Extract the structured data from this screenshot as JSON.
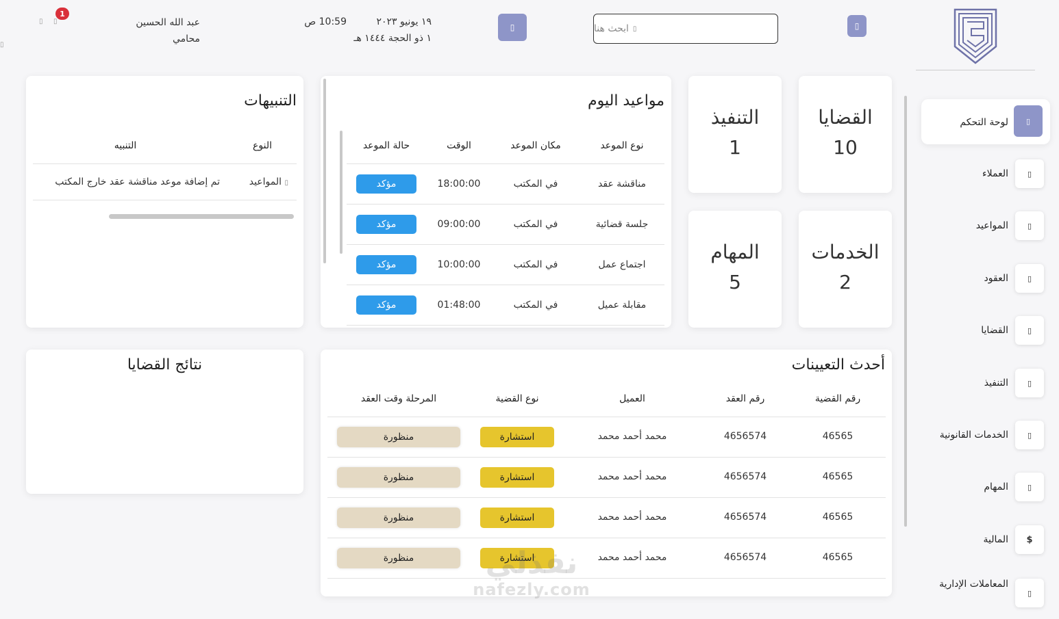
{
  "header": {
    "search_placeholder": "ابحث هنا",
    "date_gregorian": "١٩ يونيو ٢٠٢٣",
    "date_hijri": "١ ذو الحجة ١٤٤٤ هـ",
    "time": "10:59 ص",
    "user_name": "عبد الله الحسين",
    "user_role": "محامي",
    "notification_count": "1"
  },
  "sidebar": {
    "items": [
      {
        "label": "لوحة التحكم",
        "icon": "dashboard-icon"
      },
      {
        "label": "العملاء",
        "icon": "clients-icon"
      },
      {
        "label": "المواعيد",
        "icon": "calendar-icon"
      },
      {
        "label": "العقود",
        "icon": "contract-icon"
      },
      {
        "label": "القضايا",
        "icon": "case-icon"
      },
      {
        "label": "التنفيذ",
        "icon": "execution-icon"
      },
      {
        "label": "الخدمات القانونية",
        "icon": "services-icon"
      },
      {
        "label": "المهام",
        "icon": "tasks-icon"
      },
      {
        "label": "المالية",
        "icon": "dollar-icon",
        "glyph": "$"
      },
      {
        "label": "المعاملات الإدارية",
        "icon": "admin-icon"
      }
    ]
  },
  "stats": {
    "cases": {
      "label": "القضايا",
      "value": "10"
    },
    "execution": {
      "label": "التنفيذ",
      "value": "1"
    },
    "services": {
      "label": "الخدمات",
      "value": "2"
    },
    "tasks": {
      "label": "المهام",
      "value": "5"
    }
  },
  "appointments": {
    "title": "مواعيد اليوم",
    "columns": [
      "نوع الموعد",
      "مكان الموعد",
      "الوقت",
      "حالة الموعد"
    ],
    "rows": [
      {
        "type": "مناقشة عقد",
        "place": "في المكتب",
        "time": "18:00:00",
        "status": "مؤكد"
      },
      {
        "type": "جلسة قضائية",
        "place": "في المكتب",
        "time": "09:00:00",
        "status": "مؤكد"
      },
      {
        "type": "اجتماع عمل",
        "place": "في المكتب",
        "time": "10:00:00",
        "status": "مؤكد"
      },
      {
        "type": "مقابلة عميل",
        "place": "في المكتب",
        "time": "01:48:00",
        "status": "مؤكد"
      }
    ]
  },
  "alerts": {
    "title": "التنبيهات",
    "columns": [
      "النوع",
      "التنبيه"
    ],
    "rows": [
      {
        "type": "المواعيد",
        "message": "تم إضافة موعد مناقشة عقد خارج المكتب"
      }
    ]
  },
  "assignments": {
    "title": "أحدث التعيينات",
    "columns": [
      "رقم القضية",
      "رقم العقد",
      "العميل",
      "نوع القضية",
      "المرحلة وقت العقد"
    ],
    "rows": [
      {
        "case_no": "46565",
        "contract_no": "4656574",
        "client": "محمد أحمد محمد",
        "case_type": "استشارة",
        "stage": "منظورة"
      },
      {
        "case_no": "46565",
        "contract_no": "4656574",
        "client": "محمد أحمد محمد",
        "case_type": "استشارة",
        "stage": "منظورة"
      },
      {
        "case_no": "46565",
        "contract_no": "4656574",
        "client": "محمد أحمد محمد",
        "case_type": "استشارة",
        "stage": "منظورة"
      },
      {
        "case_no": "46565",
        "contract_no": "4656574",
        "client": "محمد أحمد محمد",
        "case_type": "استشارة",
        "stage": "منظورة"
      }
    ]
  },
  "results": {
    "title": "نتائج القضايا"
  },
  "watermark": {
    "line1": "نفذلي",
    "line2": "nafezly.com"
  },
  "colors": {
    "accent": "#8e95c8",
    "confirmed": "#2e9bea",
    "consultation": "#e6c52d",
    "pending_stage": "#e4d9c3",
    "badge": "#d9303a"
  }
}
